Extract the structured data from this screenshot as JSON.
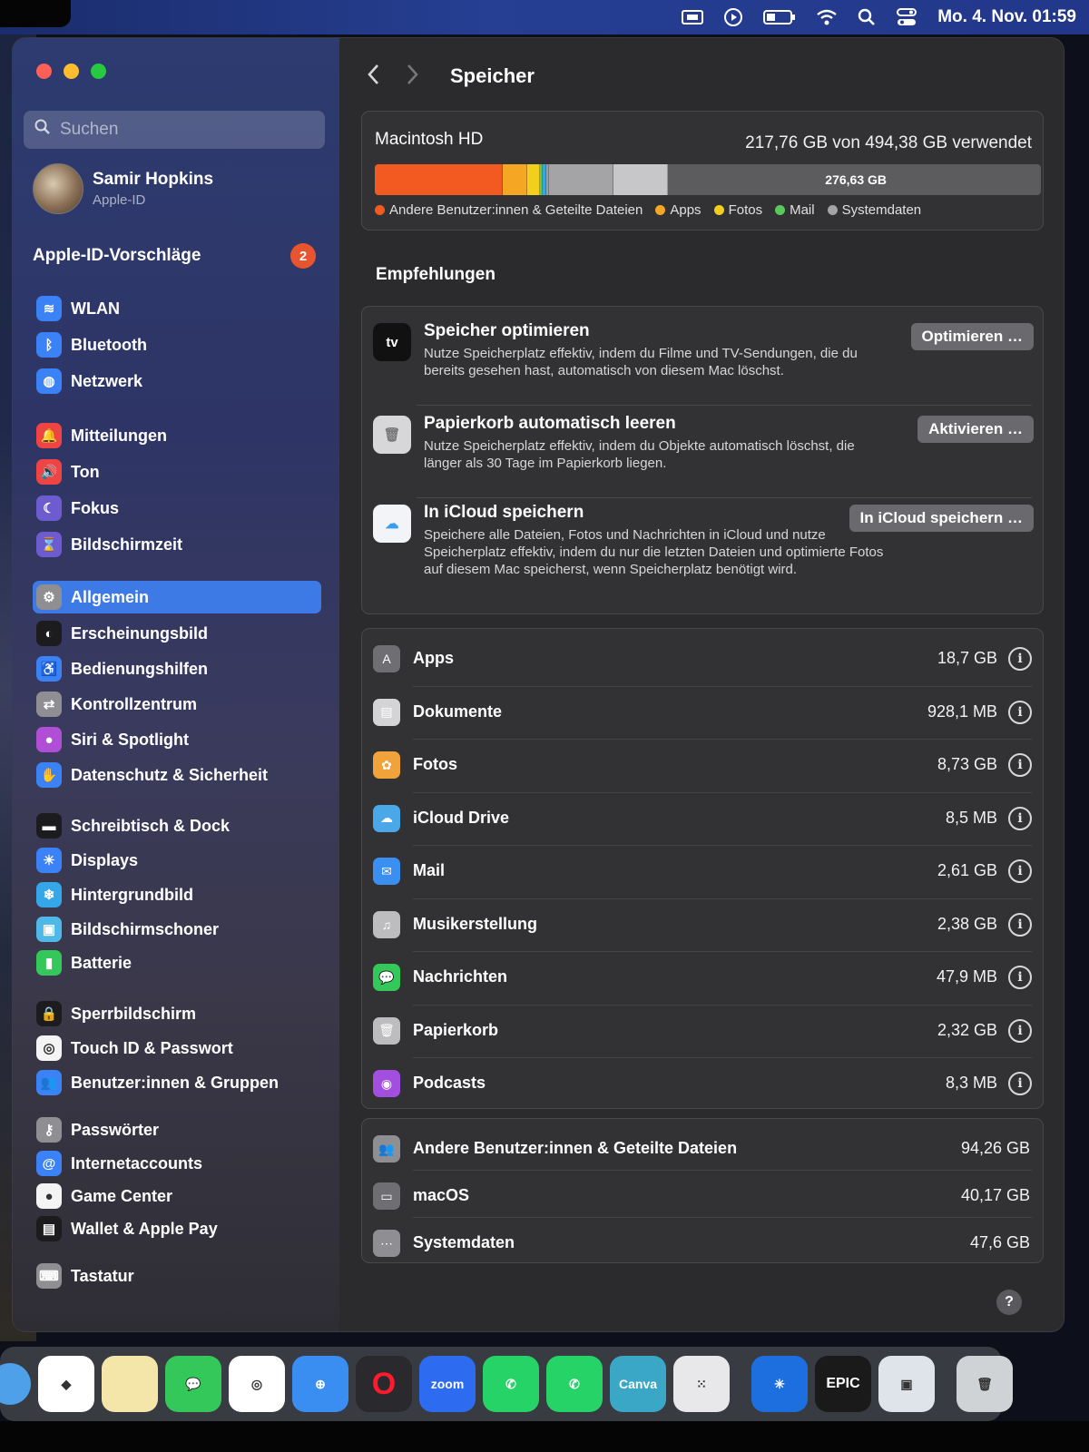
{
  "menubar": {
    "datetime": "Mo. 4. Nov.  01:59",
    "icons": [
      "display-icon",
      "play-icon",
      "battery-icon",
      "wifi-icon",
      "search-icon",
      "control-center-icon"
    ]
  },
  "sidebar": {
    "search_placeholder": "Suchen",
    "profile": {
      "name": "Samir Hopkins",
      "sub": "Apple-ID"
    },
    "suggestions": {
      "label": "Apple-ID-Vorschläge",
      "count": "2"
    },
    "items": [
      {
        "label": "WLAN",
        "icon": "wifi-icon",
        "color": "#3b82f6"
      },
      {
        "label": "Bluetooth",
        "icon": "bluetooth-icon",
        "color": "#3b82f6"
      },
      {
        "label": "Netzwerk",
        "icon": "globe-icon",
        "color": "#3b82f6"
      },
      {
        "label": "Mitteilungen",
        "icon": "bell-icon",
        "color": "#ef4444"
      },
      {
        "label": "Ton",
        "icon": "speaker-icon",
        "color": "#ef4444"
      },
      {
        "label": "Fokus",
        "icon": "moon-icon",
        "color": "#6d5bd0"
      },
      {
        "label": "Bildschirmzeit",
        "icon": "hourglass-icon",
        "color": "#6d5bd0"
      },
      {
        "label": "Allgemein",
        "icon": "gear-icon",
        "color": "#8e8e93",
        "selected": true
      },
      {
        "label": "Erscheinungsbild",
        "icon": "appearance-icon",
        "color": "#1c1c1e"
      },
      {
        "label": "Bedienungshilfen",
        "icon": "accessibility-icon",
        "color": "#3b82f6"
      },
      {
        "label": "Kontrollzentrum",
        "icon": "toggles-icon",
        "color": "#8e8e93"
      },
      {
        "label": "Siri & Spotlight",
        "icon": "siri-icon",
        "color": "#b04ed6"
      },
      {
        "label": "Datenschutz & Sicherheit",
        "icon": "hand-icon",
        "color": "#3b82f6"
      },
      {
        "label": "Schreibtisch & Dock",
        "icon": "dock-icon",
        "color": "#1c1c1e"
      },
      {
        "label": "Displays",
        "icon": "sun-icon",
        "color": "#3b82f6"
      },
      {
        "label": "Hintergrundbild",
        "icon": "snowflake-icon",
        "color": "#35a6e8"
      },
      {
        "label": "Bildschirmschoner",
        "icon": "screensaver-icon",
        "color": "#4fb8e8"
      },
      {
        "label": "Batterie",
        "icon": "battery-icon",
        "color": "#34c759"
      },
      {
        "label": "Sperrbildschirm",
        "icon": "lock-icon",
        "color": "#1c1c1e"
      },
      {
        "label": "Touch ID & Passwort",
        "icon": "fingerprint-icon",
        "color": "#f4f4f4"
      },
      {
        "label": "Benutzer:innen & Gruppen",
        "icon": "users-icon",
        "color": "#3b82f6"
      },
      {
        "label": "Passwörter",
        "icon": "key-icon",
        "color": "#8e8e93"
      },
      {
        "label": "Internetaccounts",
        "icon": "at-icon",
        "color": "#3b82f6"
      },
      {
        "label": "Game Center",
        "icon": "gamecenter-icon",
        "color": "#f4f4f4"
      },
      {
        "label": "Wallet & Apple Pay",
        "icon": "wallet-icon",
        "color": "#1c1c1e"
      },
      {
        "label": "Tastatur",
        "icon": "keyboard-icon",
        "color": "#8e8e93"
      }
    ]
  },
  "main": {
    "back_icon": "chevron-left-icon",
    "forward_icon": "chevron-right-icon",
    "title": "Speicher",
    "disk": {
      "name": "Macintosh HD",
      "used_text": "217,76 GB von 494,38 GB verwendet",
      "free_text": "276,63 GB",
      "used_fraction": 0.4405,
      "segments": [
        {
          "name": "andere",
          "color": "#f25a22",
          "gb": 94.26
        },
        {
          "name": "apps",
          "color": "#f5a623",
          "gb": 18.7
        },
        {
          "name": "fotos",
          "color": "#f2cf1d",
          "gb": 8.73
        },
        {
          "name": "mail",
          "color": "#5ac85a",
          "gb": 2.61
        },
        {
          "name": "musik",
          "color": "#3aa8e0",
          "gb": 2.38
        },
        {
          "name": "papierkorb",
          "color": "#9aa0a8",
          "gb": 2.32
        },
        {
          "name": "system",
          "color": "#a4a4a6",
          "gb": 47.6
        },
        {
          "name": "macos",
          "color": "#c7c7c9",
          "gb": 40.17
        }
      ],
      "legend": [
        {
          "label": "Andere Benutzer:innen & Geteilte Dateien",
          "color": "#f25a22"
        },
        {
          "label": "Apps",
          "color": "#f5a623"
        },
        {
          "label": "Fotos",
          "color": "#f2cf1d"
        },
        {
          "label": "Mail",
          "color": "#5ac85a"
        },
        {
          "label": "Systemdaten",
          "color": "#a4a4a6"
        }
      ]
    },
    "recommendations_heading": "Empfehlungen",
    "recommendations": [
      {
        "title": "Speicher optimieren",
        "desc": "Nutze Speicherplatz effektiv, indem du Filme und TV-Sendungen, die du bereits gesehen hast, automatisch von diesem Mac löschst.",
        "button": "Optimieren …",
        "icon": "appletv-icon",
        "icon_text": "tv"
      },
      {
        "title": "Papierkorb automatisch leeren",
        "desc": "Nutze Speicherplatz effektiv, indem du Objekte automatisch löschst, die länger als 30 Tage im Papierkorb liegen.",
        "button": "Aktivieren …",
        "icon": "trash-icon",
        "icon_text": "🗑"
      },
      {
        "title": "In iCloud speichern",
        "desc": "Speichere alle Dateien, Fotos und Nachrichten in iCloud und nutze Speicherplatz effektiv, indem du nur die letzten Dateien und optimierte Fotos auf diesem Mac speicherst, wenn Speicherplatz benötigt wird.",
        "button": "In iCloud speichern …",
        "icon": "icloud-icon",
        "icon_text": "☁"
      }
    ],
    "categories": [
      {
        "name": "Apps",
        "size": "18,7 GB",
        "icon": "appstore-icon",
        "color": "#6e6e73",
        "glyph": "A"
      },
      {
        "name": "Dokumente",
        "size": "928,1 MB",
        "icon": "document-icon",
        "color": "#d4d4d6",
        "glyph": "▤"
      },
      {
        "name": "Fotos",
        "size": "8,73 GB",
        "icon": "photos-icon",
        "color": "#f0a33a",
        "glyph": "✿"
      },
      {
        "name": "iCloud Drive",
        "size": "8,5 MB",
        "icon": "icloud-drive-icon",
        "color": "#4aa7e8",
        "glyph": "☁"
      },
      {
        "name": "Mail",
        "size": "2,61 GB",
        "icon": "mail-icon",
        "color": "#3b8ff0",
        "glyph": "✉"
      },
      {
        "name": "Musikerstellung",
        "size": "2,38 GB",
        "icon": "music-creation-icon",
        "color": "#bdbdbf",
        "glyph": "♫"
      },
      {
        "name": "Nachrichten",
        "size": "47,9 MB",
        "icon": "messages-icon",
        "color": "#34c759",
        "glyph": "💬"
      },
      {
        "name": "Papierkorb",
        "size": "2,32 GB",
        "icon": "trash-icon",
        "color": "#bdbdbf",
        "glyph": "🗑"
      },
      {
        "name": "Podcasts",
        "size": "8,3 MB",
        "icon": "podcasts-icon",
        "color": "#a24ede",
        "glyph": "◉"
      }
    ],
    "system": [
      {
        "name": "Andere Benutzer:innen & Geteilte Dateien",
        "size": "94,26 GB",
        "icon": "users-icon",
        "color": "#8e8e93",
        "glyph": "👥"
      },
      {
        "name": "macOS",
        "size": "40,17 GB",
        "icon": "laptop-icon",
        "color": "#6e6e73",
        "glyph": "▭"
      },
      {
        "name": "Systemdaten",
        "size": "47,6 GB",
        "icon": "ellipsis-icon",
        "color": "#8e8e93",
        "glyph": "⋯"
      }
    ],
    "help": "?"
  },
  "dock": {
    "apps": [
      {
        "name": "Finder",
        "icon": "finder-icon",
        "color": "#4ea0e8",
        "glyph": ""
      },
      {
        "name": "Dropbox",
        "icon": "dropbox-icon",
        "color": "#ffffff",
        "glyph": "◆"
      },
      {
        "name": "Notizen",
        "icon": "notes-icon",
        "color": "#f4e6a8",
        "glyph": ""
      },
      {
        "name": "Nachrichten",
        "icon": "messages-icon",
        "color": "#34c759",
        "glyph": "💬"
      },
      {
        "name": "Chrome",
        "icon": "chrome-icon",
        "color": "#ffffff",
        "glyph": "◎"
      },
      {
        "name": "Safari",
        "icon": "safari-icon",
        "color": "#3a8ef2",
        "glyph": "⊕"
      },
      {
        "name": "Opera",
        "icon": "opera-icon",
        "color": "#2a2a2e",
        "glyph": "O"
      },
      {
        "name": "zoom",
        "icon": "zoom-icon",
        "color": "#2d6cf0",
        "glyph": "zoom"
      },
      {
        "name": "WhatsApp",
        "icon": "whatsapp-icon",
        "color": "#25d366",
        "glyph": "✆"
      },
      {
        "name": "WhatsApp",
        "icon": "whatsapp-icon",
        "color": "#25d366",
        "glyph": "✆"
      },
      {
        "name": "Canva",
        "icon": "canva-icon",
        "color": "#3ba7c7",
        "glyph": "Canva"
      },
      {
        "name": "Launchpad",
        "icon": "launchpad-icon",
        "color": "#e8e8ea",
        "glyph": "⁙"
      },
      {
        "name": "Battle.net",
        "icon": "battlenet-icon",
        "color": "#1d6fe0",
        "glyph": "✳"
      },
      {
        "name": "Epic Games",
        "icon": "epic-games-icon",
        "color": "#1a1a1a",
        "glyph": "EPIC"
      },
      {
        "name": "Vorschau",
        "icon": "preview-icon",
        "color": "#dfe4ea",
        "glyph": "▣"
      },
      {
        "name": "Papierkorb",
        "icon": "trash-icon",
        "color": "#cfd3d6",
        "glyph": "🗑"
      }
    ]
  }
}
